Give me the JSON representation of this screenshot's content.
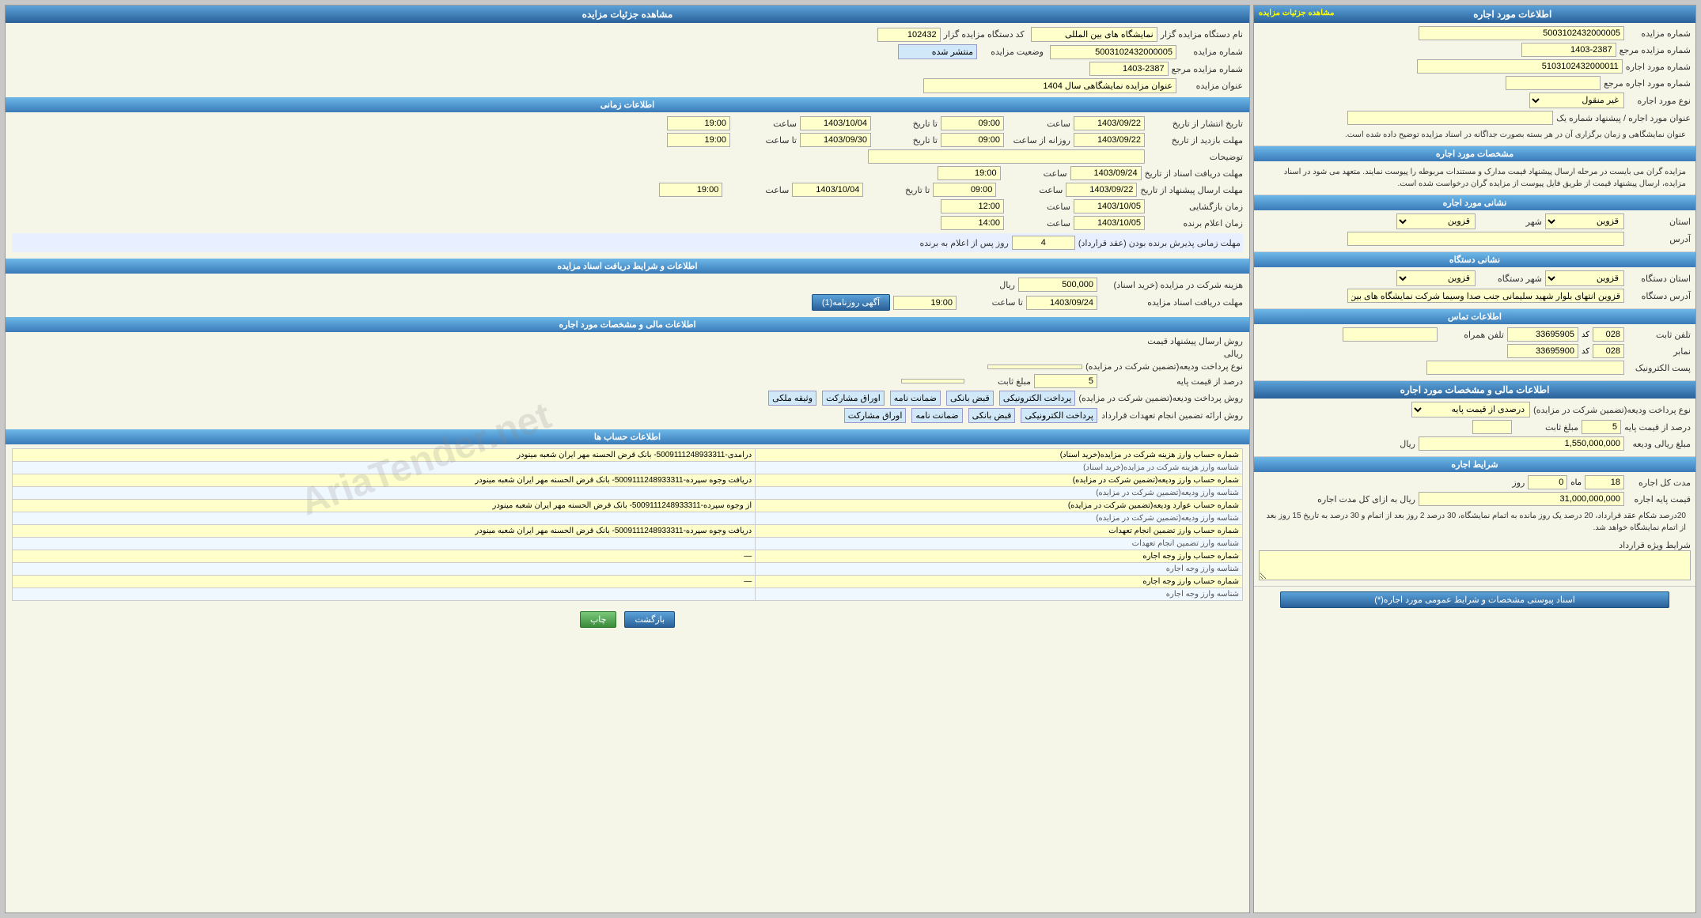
{
  "left_panel": {
    "title": "اطلاعات مورد اجاره",
    "link_label": "مشاهده جزئیات مزایده",
    "fields": {
      "auction_number_label": "شماره مزایده",
      "auction_number_value": "5003102432000005",
      "ref_number_label": "شماره مزایده مرجع",
      "ref_number_value": "1403-2387",
      "lease_number_label": "شماره مورد اجاره",
      "lease_number_value": "5103102432000011",
      "ref_lease_label": "شماره مورد اجاره مرجع",
      "type_label": "نوع مورد اجاره",
      "type_value": "غیر منقول",
      "title_label": "عنوان مورد اجاره / پیشنهاد شماره یک",
      "desc_label": "عنوان نمایشگاهی و زمان برگزاری آن در هر بسته بصورت جداگانه در اسناد مزایده توضیح داده شده است."
    },
    "lease_specs_title": "مشخصات مورد اجاره",
    "lease_specs_text": "مزایده گران می بایست در مرحله ارسال پیشنهاد قیمت مدارک و مستندات مربوطه را پیوست نمایند.\nمتعهد می شود در اسناد مزایده، ارسال پیشنهاد قیمت از طریق فایل پیوست از مزایده گران درخواست شده است.",
    "location_title": "نشانی مورد اجاره",
    "province_label": "استان",
    "province_value": "قزوین",
    "city_label": "شهر",
    "city_value": "قزوین",
    "address_label": "آدرس",
    "address_value": "",
    "device_title": "نشانی دستگاه",
    "device_province_label": "استان دستگاه",
    "device_province_value": "قزوین",
    "device_city_label": "شهر دستگاه",
    "device_city_value": "قزوین",
    "device_address_label": "آدرس دستگاه",
    "device_address_value": "قزوین انتهای بلوار شهید سلیمانی جنب صدا وسیما شرکت نمایشگاه های بین المللی",
    "contact_title": "اطلاعات تماس",
    "phone_label": "تلفن ثابت",
    "phone_code": "028",
    "phone_number": "33695905",
    "phone_mobile_label": "تلفن همراه",
    "fax_label": "نمابر",
    "fax_code": "028",
    "fax_number": "33695900",
    "email_label": "پست الکترونیک",
    "financial_title": "اطلاعات مالی و مشخصات مورد اجاره",
    "deposit_label": "نوع پرداخت ودیعه(تضمین شرکت در مزایده)",
    "deposit_option": "درصدی از قیمت پایه",
    "deposit_percent_label": "درصد از قیمت پایه",
    "deposit_percent_value": "5",
    "fixed_amount_label": "مبلغ ثابت",
    "deposit_amount_label": "مبلغ ریالی ودیعه",
    "deposit_amount_value": "1,550,000,000",
    "deposit_currency": "ریال",
    "conditions_title": "شرایط اجاره",
    "duration_label": "مدت کل اجاره",
    "duration_month": "18",
    "duration_day": "0",
    "duration_unit": "روز",
    "base_price_label": "قیمت پایه اجاره",
    "base_price_value": "31,000,000,000",
    "base_price_unit": "ریال به ازای کل مدت اجاره",
    "conditions_text": "20درصد شکام عقد قرارداد، 20 درصد یک روز مانده به اتمام نمایشگاه، 30 درصد 2 روز بعد از اتمام و 30 درصد به تاریخ 15 روز بعد از اتمام نمایشگاه خواهد شد.",
    "special_conditions_label": "شرایط ویژه قرارداد",
    "download_button": "اسناد پیوستی مشخصات و شرایط عمومی مورد اجاره(*)"
  },
  "right_panel": {
    "title": "مشاهده جزئیات مزایده",
    "fields": {
      "auction_org_label": "نام دستگاه مزایده گزار",
      "auction_org_value": "نمایشگاه های بین المللی",
      "auction_code_label": "کد دستگاه مزایده گزار",
      "auction_code_value": "102432",
      "auction_number_label": "شماره مزایده",
      "auction_number_value": "5003102432000005",
      "status_label": "وضعیت مزایده",
      "status_value": "منتشر شده",
      "ref_number_label": "شماره مزایده مرجع",
      "ref_number_value": "1403-2387",
      "title_label": "عنوان مزایده",
      "title_value": "عنوان مزایده نمایشگاهی سال 1404"
    },
    "time_section": {
      "title": "اطلاعات زمانی",
      "publish_start_label": "تاریخ انتشار  از تاریخ",
      "publish_start_date": "1403/09/22",
      "publish_start_time_label": "ساعت",
      "publish_start_time": "09:00",
      "publish_end_label": "تا تاریخ",
      "publish_end_date": "1403/10/04",
      "publish_end_time_label": "ساعت",
      "publish_end_time": "19:00",
      "purchase_start_label": "مهلت بازدید  از تاریخ",
      "purchase_start_date": "1403/09/22",
      "purchase_start_time_label": "روزانه از ساعت",
      "purchase_start_time": "09:00",
      "purchase_end_label": "تا تاریخ",
      "purchase_end_date": "1403/09/30",
      "purchase_end_time_label": "تا ساعت",
      "purchase_end_time": "19:00",
      "notes_label": "توضیحات",
      "doc_receive_label": "مهلت دریافت اسناد  از تاریخ",
      "doc_receive_start_date": "1403/09/24",
      "doc_receive_start_time_label": "ساعت",
      "doc_receive_start_time": "19:00",
      "offer_send_label": "مهلت ارسال پیشنهاد  از تاریخ",
      "offer_send_start_date": "1403/09/22",
      "offer_send_start_time_label": "ساعت",
      "offer_send_start_time": "09:00",
      "offer_send_end_label": "تا تاریخ",
      "offer_send_end_date": "1403/10/04",
      "offer_send_end_time_label": "ساعت",
      "offer_send_end_time": "19:00",
      "opening_label": "زمان بازگشایی",
      "opening_date": "1403/10/05",
      "opening_time_label": "ساعت",
      "opening_time": "12:00",
      "winner_label": "زمان اعلام برنده",
      "winner_date": "1403/10/05",
      "winner_time_label": "ساعت",
      "winner_time": "14:00",
      "contract_days_label": "مهلت زمانی پذیرش برنده بودن (عقد قرارداد)",
      "contract_days_value": "4",
      "contract_days_unit": "روز پس از اعلام به برنده"
    },
    "financial_section": {
      "title": "اطلاعات و شرایط دریافت اسناد مزایده",
      "fee_label": "هزینه شرکت در مزایده (خرید اسناد)",
      "fee_value": "500,000",
      "fee_currency": "ریال",
      "doc_deadline_label": "مهلت دریافت اسناد مزایده",
      "doc_deadline_date": "1403/09/24",
      "doc_deadline_time_label": "تا ساعت",
      "doc_deadline_time": "19:00",
      "announcement_button": "آگهی روزنامه(1)"
    },
    "lease_financial_title": "اطلاعات مالی و مشخصات مورد اجاره",
    "lease_financial": {
      "price_method_label": "روش ارسال پیشنهاد قیمت",
      "price_currency_label": "ریالی",
      "deposit_type_label": "نوع پرداخت ودیعه(تضمین شرکت در مزایده)",
      "deposit_type_value": "",
      "deposit_percent_label": "درصد از قیمت پایه",
      "deposit_percent_value": "5",
      "fixed_amount_label": "مبلغ ثابت",
      "deposit_method_label": "روش پرداخت ودیعه(تضمین شرکت در مزایده)",
      "payment_methods": [
        "پرداخت الکترونیکی",
        "قبض بانکی",
        "ضمانت نامه",
        "اوراق مشارکت",
        "وثیقه ملکی"
      ],
      "contract_method_label": "روش ارائه تضمین انجام تعهدات قرارداد",
      "contract_methods": [
        "پرداخت الکترونیکی",
        "قبض بانکی",
        "ضمانت نامه",
        "اوراق مشارکت"
      ]
    },
    "accounts_title": "اطلاعات حساب ها",
    "accounts": [
      {
        "title_right": "شماره حساب وارز هزینه شرکت در مزایده(خرید اسناد)",
        "value_right": "درامدی-5009111248933311- بانک قرض الحسنه مهر ایران شعبه مینودر",
        "title_left": "شناسه وارز هزینه شرکت در مزایده(خرید اسناد)",
        "value_left": ""
      },
      {
        "title_right": "شماره حساب وارز ودیعه(تضمین شرکت در مزایده)",
        "value_right": "دریافت وجوه سپرده-5009111248933311- بانک قرض الحسنه مهر ایران شعبه مینودر",
        "title_left": "شناسه وارز ودیعه(تضمین شرکت در مزایده)",
        "value_left": ""
      },
      {
        "title_right": "شماره حساب عوارد ودیعه(تضمین شرکت در مزایده)",
        "value_right": "از وجوه سپرده-5009111248933311- بانک قرض الحسنه مهر ایران شعبه مینودر",
        "title_left": "شناسه وارز ودیعه(تضمین شرکت در مزایده)",
        "value_left": ""
      },
      {
        "title_right": "شماره حساب وارز تضمین انجام تعهدات",
        "value_right": "دریافت وجوه سپرده-5009111248933311- بانک قرض الحسنه مهر ایران شعبه مینودر",
        "title_left": "شناسه وارز تضمین انجام تعهدات",
        "value_left": ""
      },
      {
        "title_right": "شماره حساب وارز وجه اجاره",
        "value_right": "—",
        "title_left": "شناسه وارز وجه اجاره",
        "value_left": ""
      },
      {
        "title_right": "شماره حساب وارز وجه اجاره",
        "value_right": "—",
        "title_left": "شناسه وارز وجه اجاره",
        "value_left": ""
      }
    ],
    "buttons": {
      "print": "چاپ",
      "back": "بازگشت"
    }
  },
  "watermark": "AriaTender.net"
}
